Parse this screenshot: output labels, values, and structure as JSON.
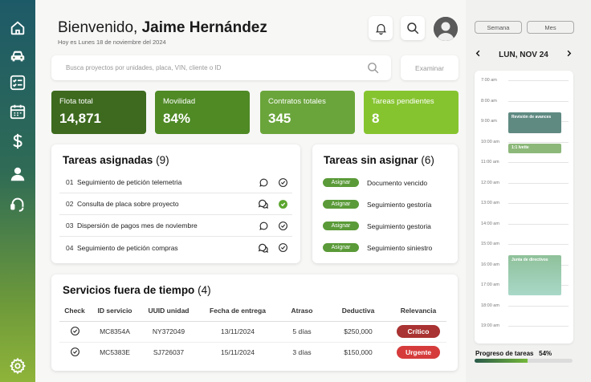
{
  "header": {
    "greeting": "Bienvenido,",
    "name": "Jaime Hernández",
    "date": "Hoy es Lunes 18 de noviembre del 2024"
  },
  "search": {
    "placeholder": "Busca proyectos por unidades, placa, VIN, cliente o ID",
    "button": "Examinar"
  },
  "stats": [
    {
      "label": "Flota total",
      "value": "14,871",
      "color": "#3d6a1e"
    },
    {
      "label": "Movilidad",
      "value": "84%",
      "color": "#4f8a25"
    },
    {
      "label": "Contratos totales",
      "value": "345",
      "color": "#6aa53b"
    },
    {
      "label": "Tareas pendientes",
      "value": "8",
      "color": "#86c42f"
    }
  ],
  "assigned": {
    "title": "Tareas asignadas",
    "count": "(9)",
    "rows": [
      {
        "n": "01",
        "text": "Seguimiento de petición telemetria",
        "chat": "single",
        "done": false
      },
      {
        "n": "02",
        "text": "Consulta de placa sobre proyecto",
        "chat": "double",
        "done": true
      },
      {
        "n": "03",
        "text": "Dispersión de pagos mes de noviembre",
        "chat": "single",
        "done": false
      },
      {
        "n": "04",
        "text": "Seguimiento de petición compras",
        "chat": "double",
        "done": false
      }
    ]
  },
  "unassigned": {
    "title": "Tareas sin asignar",
    "count": "(6)",
    "button_label": "Asignar",
    "rows": [
      "Documento vencido",
      "Seguimiento gestoría",
      "Seguimiento gestoria",
      "Seguimiento siniestro"
    ]
  },
  "services": {
    "title": "Servicios fuera de tiempo",
    "count": "(4)",
    "columns": [
      "Check",
      "ID servicio",
      "UUID unidad",
      "Fecha de entrega",
      "Atraso",
      "Deductiva",
      "Relevancia"
    ],
    "rows": [
      {
        "id": "MC8354A",
        "uuid": "NY372049",
        "date": "13/11/2024",
        "delay": "5 días",
        "amount": "$250,000",
        "relevance": "Crítico",
        "color": "#a93232"
      },
      {
        "id": "MC5383E",
        "uuid": "SJ726037",
        "date": "15/11/2024",
        "delay": "3 días",
        "amount": "$150,000",
        "relevance": "Urgente",
        "color": "#d63b3b"
      }
    ]
  },
  "calendar": {
    "view_week": "Semana",
    "view_month": "Mes",
    "day": "LUN, NOV 24",
    "slots": [
      "7:00 am",
      "8:00 am",
      "9:00 am",
      "10:00 am",
      "11:00 am",
      "12:00 am",
      "13:00 am",
      "14:00 am",
      "15:00 am",
      "16:00 am",
      "17:00 am",
      "18:00 am",
      "19:00 am"
    ],
    "events": [
      {
        "label": "Revisión de avances",
        "color": "#5f8a82"
      },
      {
        "label": "1:1 Ivette",
        "color": "#8cb87a"
      },
      {
        "label": "Junta de directivos",
        "color": "#9fcfb8"
      }
    ]
  },
  "progress": {
    "label": "Progreso de tareas",
    "value": "54%",
    "fraction": 0.54
  }
}
